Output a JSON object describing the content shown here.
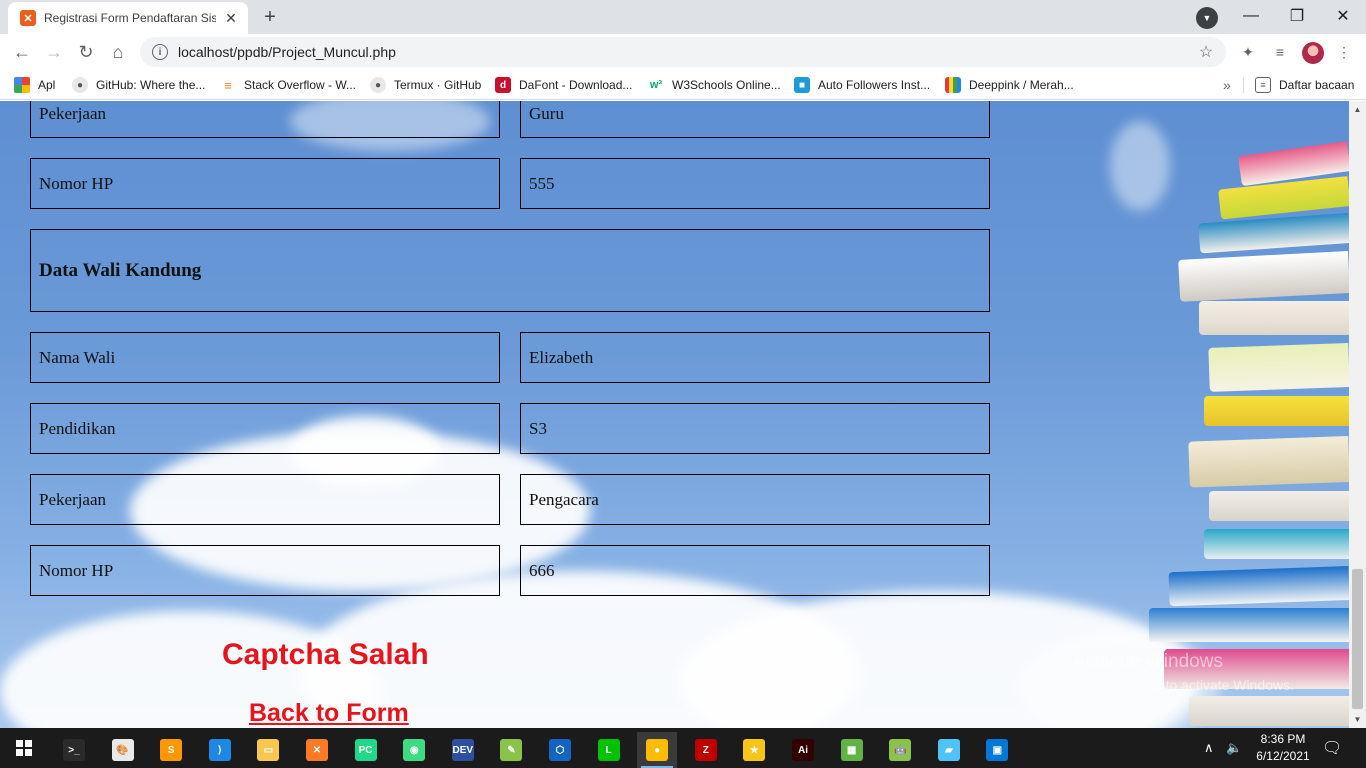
{
  "browser": {
    "tab_title": "Registrasi Form Pendaftaran Sisw",
    "url": "localhost/ppdb/Project_Muncul.php",
    "bookmarks": [
      {
        "label": "Apl",
        "icon": "apps-grid-icon"
      },
      {
        "label": "GitHub: Where the...",
        "icon": "github-icon"
      },
      {
        "label": "Stack Overflow - W...",
        "icon": "stackoverflow-icon"
      },
      {
        "label": "Termux · GitHub",
        "icon": "github-icon"
      },
      {
        "label": "DaFont - Download...",
        "icon": "dafont-icon"
      },
      {
        "label": "W3Schools Online...",
        "icon": "w3schools-icon"
      },
      {
        "label": "Auto Followers Inst...",
        "icon": "cube-icon"
      },
      {
        "label": "Deeppink / Merah...",
        "icon": "color-bars-icon"
      }
    ],
    "more_bookmarks": "»",
    "reading_list": "Daftar bacaan"
  },
  "form": {
    "ayah_pekerjaan": {
      "label": "Pekerjaan",
      "value": "Guru"
    },
    "ayah_nomor_hp": {
      "label": "Nomor HP",
      "value": "555"
    },
    "wali_heading": "Data Wali Kandung",
    "wali_nama": {
      "label": "Nama Wali",
      "value": "Elizabeth"
    },
    "wali_pendidikan": {
      "label": "Pendidikan",
      "value": "S3"
    },
    "wali_pekerjaan": {
      "label": "Pekerjaan",
      "value": "Pengacara"
    },
    "wali_nomor_hp": {
      "label": "Nomor HP",
      "value": "666"
    }
  },
  "result": {
    "captcha_message": "Captcha Salah",
    "back_link": "Back to Form"
  },
  "watermark": {
    "title": "Activate Windows",
    "subtitle": "Go to Settings to activate Windows."
  },
  "taskbar": {
    "time": "8:36 PM",
    "date": "6/12/2021",
    "apps": [
      "terminal-icon",
      "paint-icon",
      "sublime-text-icon",
      "vscode-icon",
      "file-explorer-icon",
      "xampp-icon",
      "pycharm-icon",
      "android-studio-icon",
      "devcpp-icon",
      "notepad-icon",
      "virtualbox-icon",
      "line-icon",
      "chrome-icon",
      "filezilla-icon",
      "star-app-icon",
      "illustrator-icon",
      "bluestacks-icon",
      "android-icon",
      "pen-tool-icon",
      "photos-icon"
    ]
  },
  "colors": {
    "error_red": "#e8141c",
    "sky_blue": "#6b9ad8"
  }
}
